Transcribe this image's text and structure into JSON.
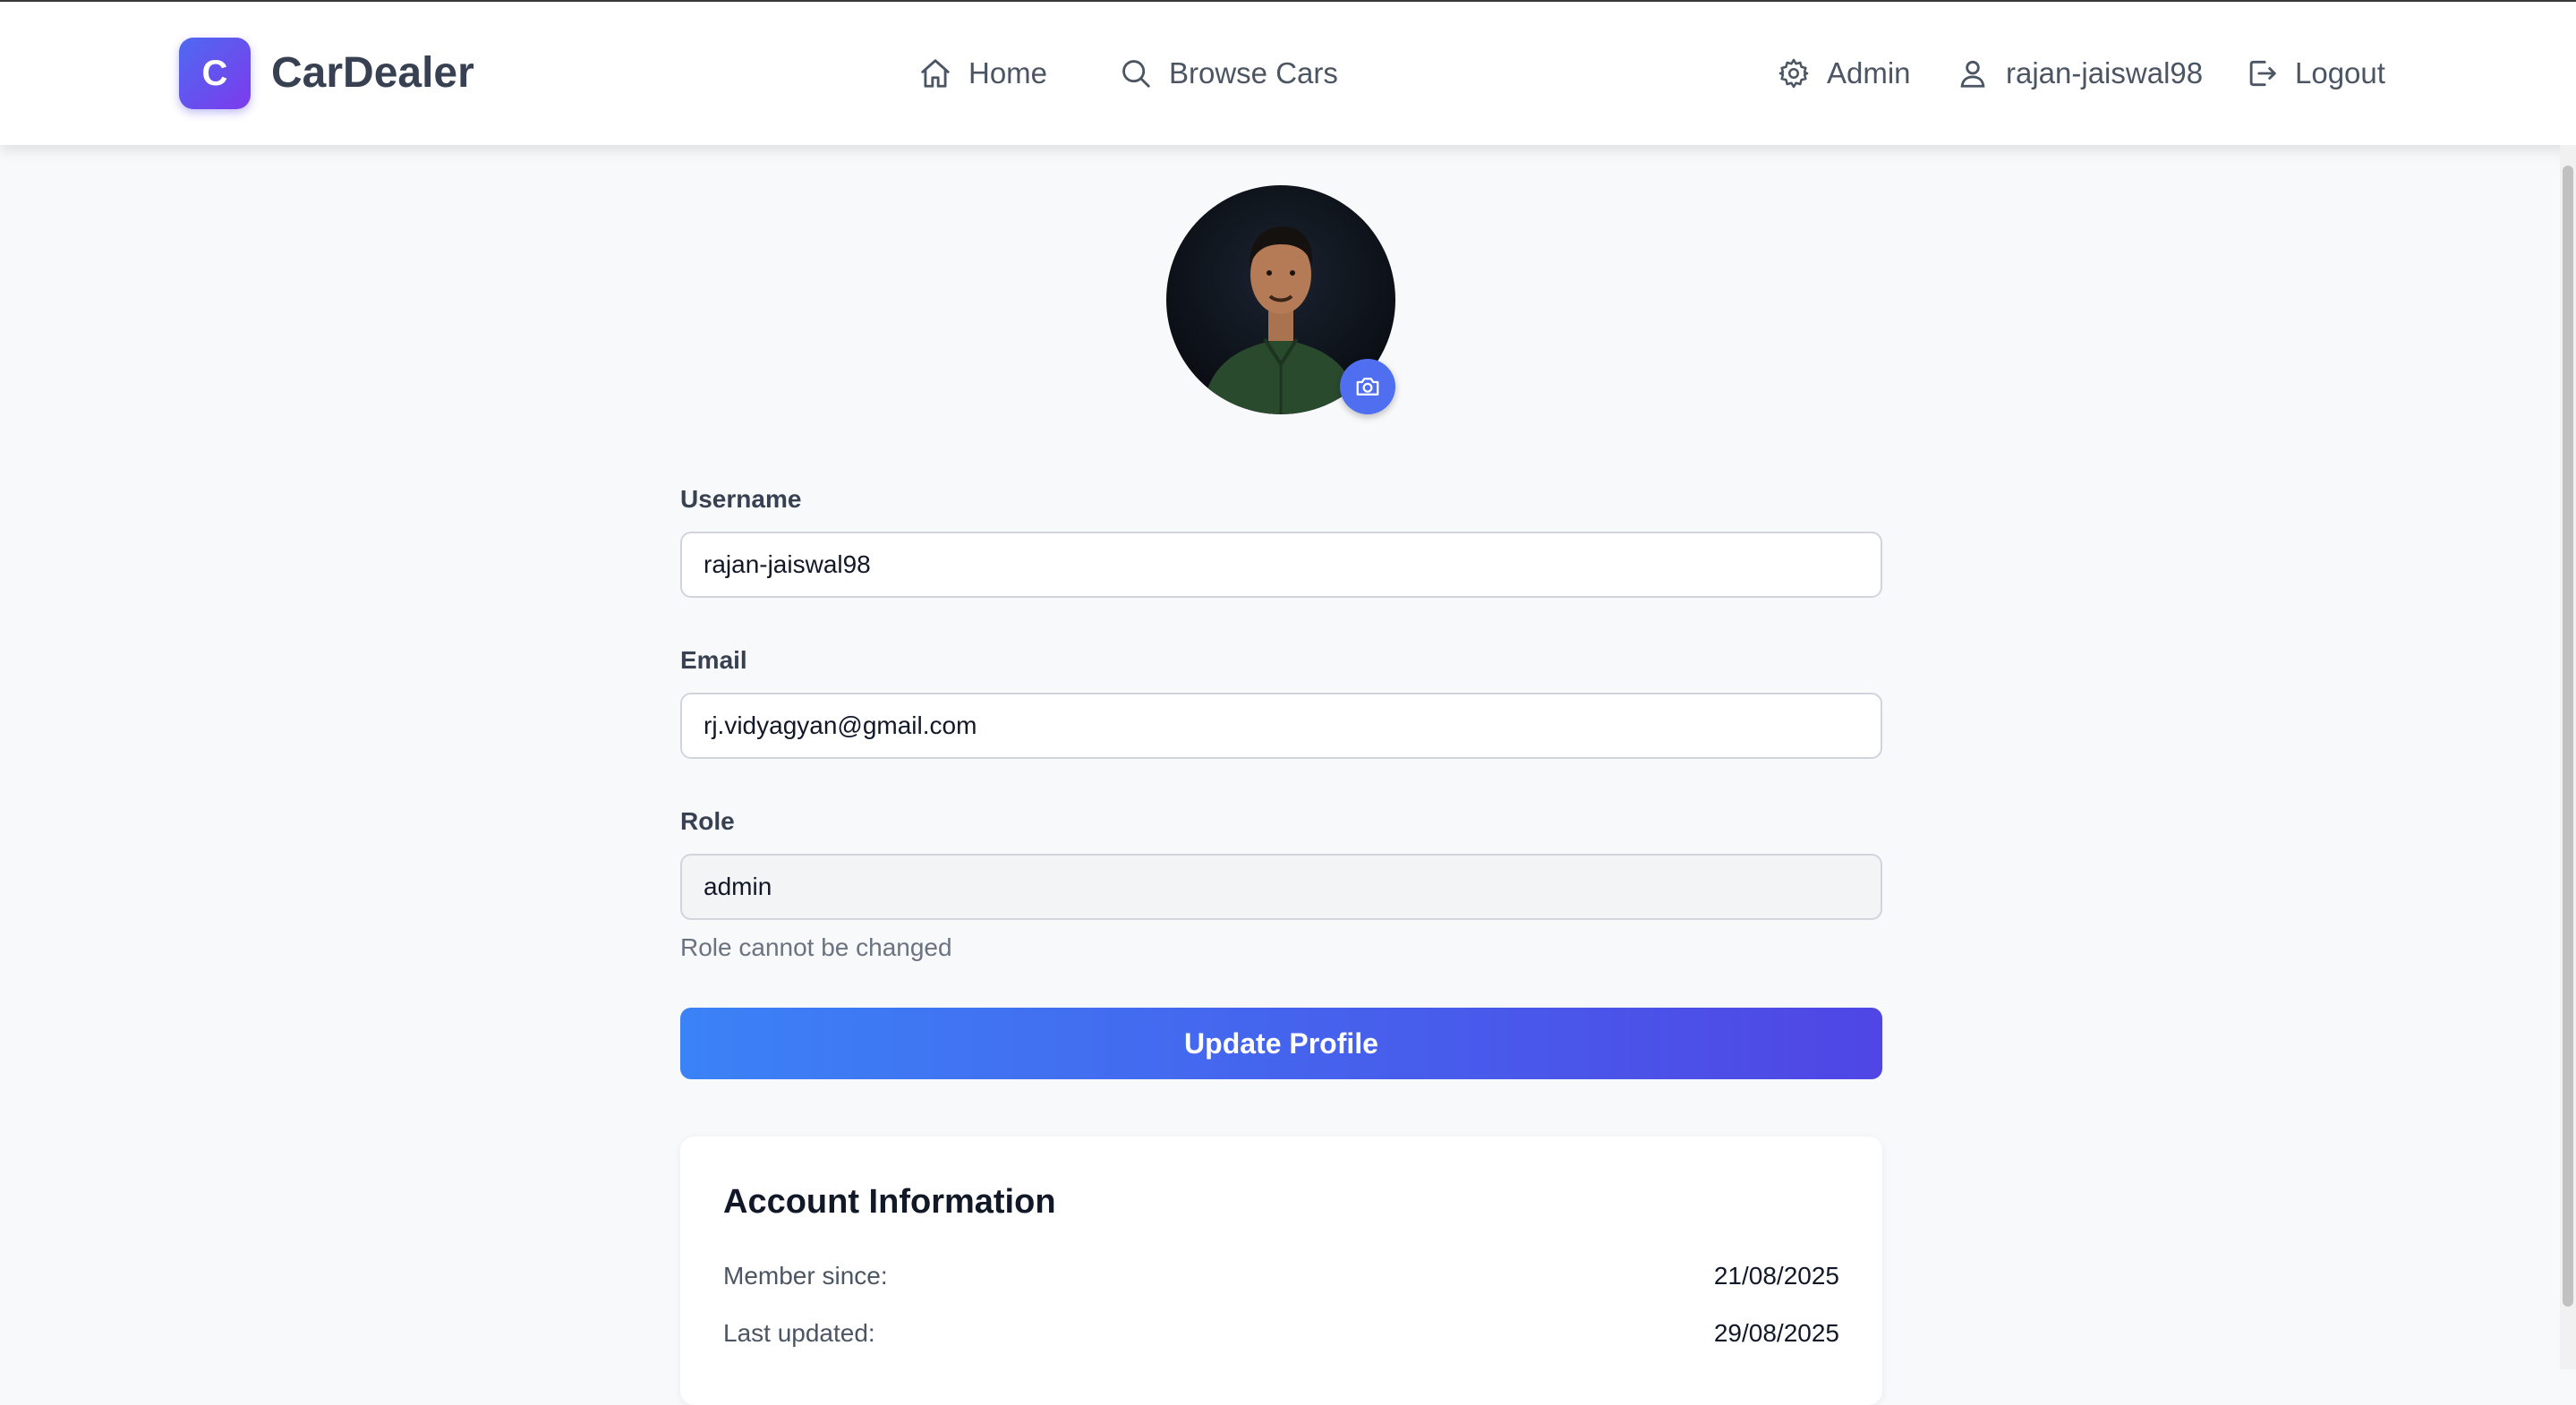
{
  "nav": {
    "logo_letter": "C",
    "brand": "CarDealer",
    "home": "Home",
    "browse": "Browse Cars",
    "admin": "Admin",
    "user": "rajan-jaiswal98",
    "logout": "Logout"
  },
  "form": {
    "username_label": "Username",
    "username_value": "rajan-jaiswal98",
    "email_label": "Email",
    "email_value": "rj.vidyagyan@gmail.com",
    "role_label": "Role",
    "role_value": "admin",
    "role_help": "Role cannot be changed",
    "submit": "Update Profile"
  },
  "account": {
    "title": "Account Information",
    "member_since_label": "Member since:",
    "member_since": "21/08/2025",
    "last_updated_label": "Last updated:",
    "last_updated": "29/08/2025"
  },
  "colors": {
    "accent": "#4f46e5",
    "accent_blue": "#3b82f6"
  },
  "icons": {
    "home": "home-icon",
    "browse": "search-icon",
    "admin": "gear-icon",
    "user": "user-icon",
    "logout": "logout-icon",
    "avatar_upload": "camera-icon"
  }
}
